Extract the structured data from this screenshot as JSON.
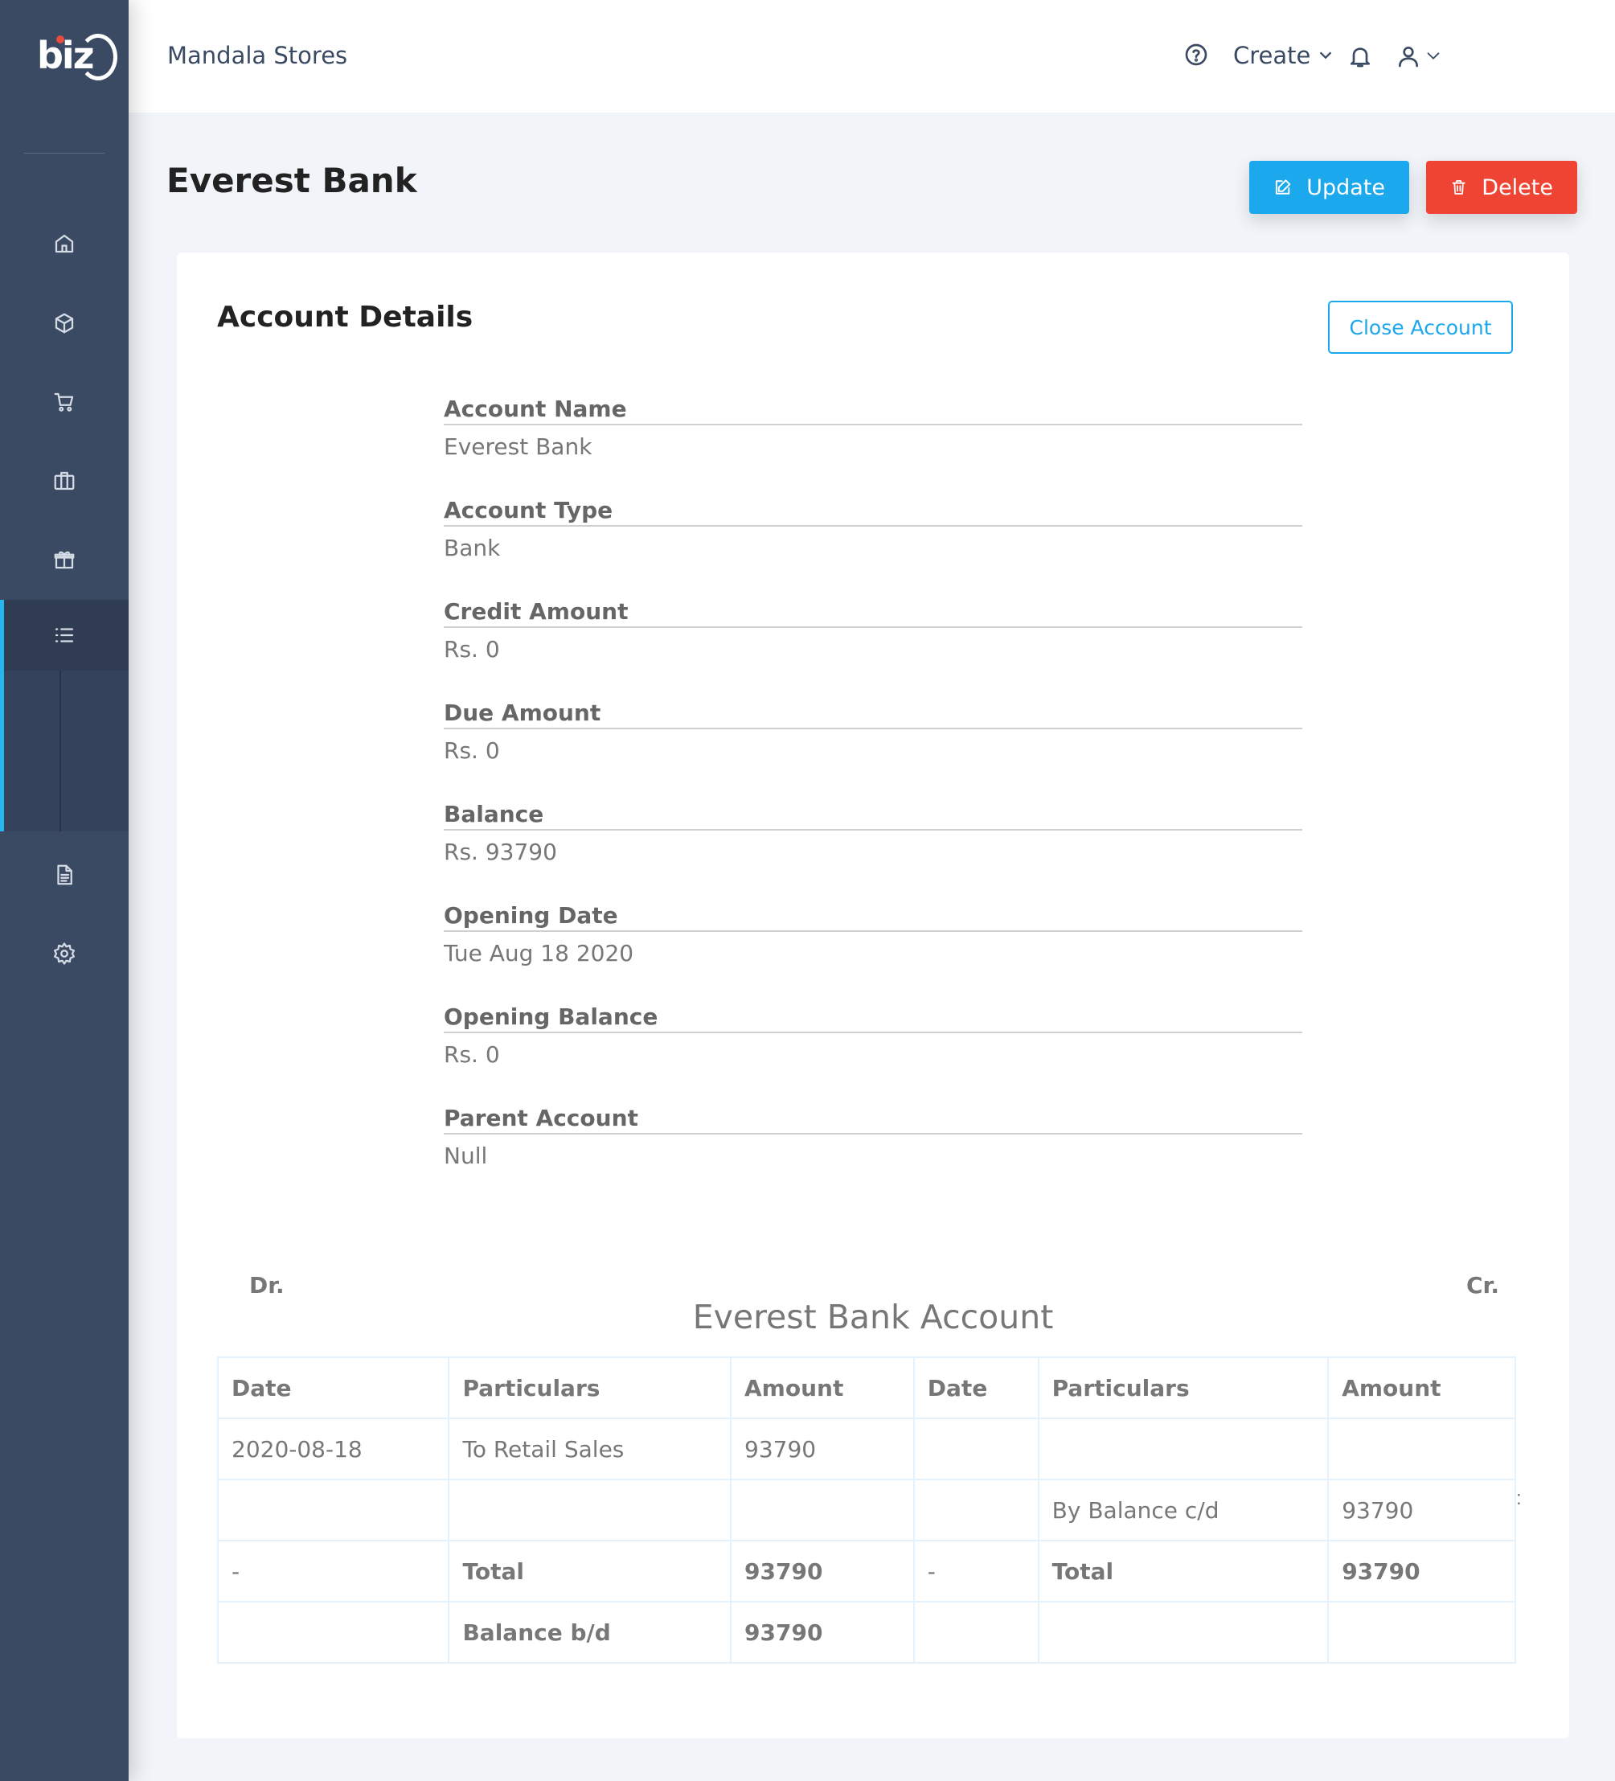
{
  "app": {
    "logo_text": "biz",
    "store_name": "Mandala Stores"
  },
  "sidebar": {
    "items": [
      {
        "name": "home",
        "icon": "home-icon"
      },
      {
        "name": "products",
        "icon": "box-icon"
      },
      {
        "name": "cart",
        "icon": "cart-icon"
      },
      {
        "name": "briefcase",
        "icon": "briefcase-icon"
      },
      {
        "name": "gifts",
        "icon": "gift-icon"
      },
      {
        "name": "accounts",
        "icon": "list-icon",
        "active": true
      },
      {
        "name": "reports",
        "icon": "document-icon"
      },
      {
        "name": "settings",
        "icon": "gear-icon"
      }
    ]
  },
  "header": {
    "create_label": "Create"
  },
  "page": {
    "title": "Everest Bank",
    "update_label": "Update",
    "delete_label": "Delete"
  },
  "card": {
    "title": "Account Details",
    "close_account_label": "Close Account",
    "details": [
      {
        "label": "Account Name",
        "value": "Everest Bank"
      },
      {
        "label": "Account Type",
        "value": "Bank"
      },
      {
        "label": "Credit Amount",
        "value": "Rs. 0"
      },
      {
        "label": "Due Amount",
        "value": "Rs. 0"
      },
      {
        "label": "Balance",
        "value": "Rs. 93790"
      },
      {
        "label": "Opening Date",
        "value": "Tue Aug 18 2020"
      },
      {
        "label": "Opening Balance",
        "value": "Rs. 0"
      },
      {
        "label": "Parent Account",
        "value": "Null"
      }
    ]
  },
  "ledger": {
    "dr_label": "Dr.",
    "title": "Everest Bank Account",
    "cr_label": "Cr.",
    "headers": [
      "Date",
      "Particulars",
      "Amount",
      "Date",
      "Particulars",
      "Amount"
    ],
    "rows": [
      [
        "2020-08-18",
        "To Retail Sales",
        "93790",
        "",
        "",
        ""
      ],
      [
        "",
        "",
        "",
        "",
        "By Balance c/d",
        "93790"
      ],
      [
        "-",
        "Total",
        "93790",
        "-",
        "Total",
        "93790"
      ],
      [
        "",
        "Balance b/d",
        "93790",
        "",
        "",
        ""
      ]
    ],
    "stray_mark": ":"
  },
  "colors": {
    "sidebar": "#3b4a63",
    "accent": "#1ba8ec",
    "danger": "#ef4434"
  }
}
